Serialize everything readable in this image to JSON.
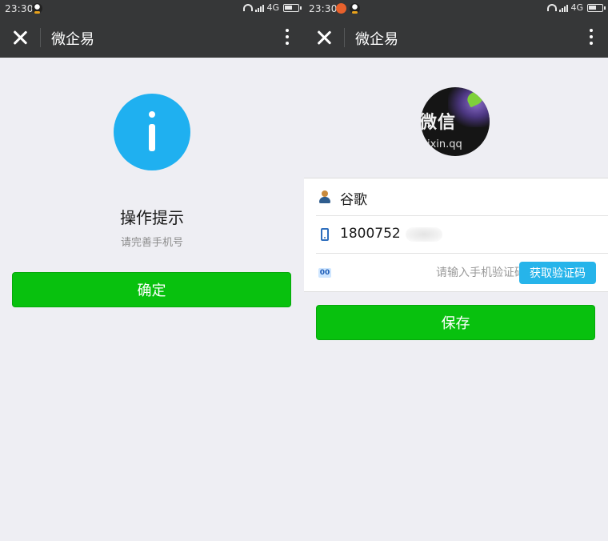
{
  "left": {
    "status_bar": {
      "time": "23:30",
      "network": "4G"
    },
    "nav": {
      "title": "微企易"
    },
    "dialog": {
      "title": "操作提示",
      "message": "请完善手机号",
      "confirm_label": "确定"
    }
  },
  "right": {
    "status_bar": {
      "time": "23:30",
      "network": "4G"
    },
    "nav": {
      "title": "微企易"
    },
    "avatar": {
      "text_line1": "微信",
      "text_line2": "ixin.qq"
    },
    "form": {
      "name_value": "谷歌",
      "phone_value": "1800752",
      "code_placeholder": "请输入手机验证码",
      "get_code_label": "获取验证码",
      "code_icon_text": "00"
    },
    "save_label": "保存"
  },
  "colors": {
    "nav_bg": "#363738",
    "page_bg": "#eeeef3",
    "primary_green": "#08c10e",
    "info_blue": "#1fb0f0",
    "code_button_blue": "#26b4ea"
  },
  "icons": [
    "close-icon",
    "more-icon",
    "info-icon",
    "user-icon",
    "phone-icon",
    "code-icon",
    "wifi-icon",
    "signal-icon",
    "battery-icon",
    "qq-icon",
    "weibo-icon"
  ]
}
